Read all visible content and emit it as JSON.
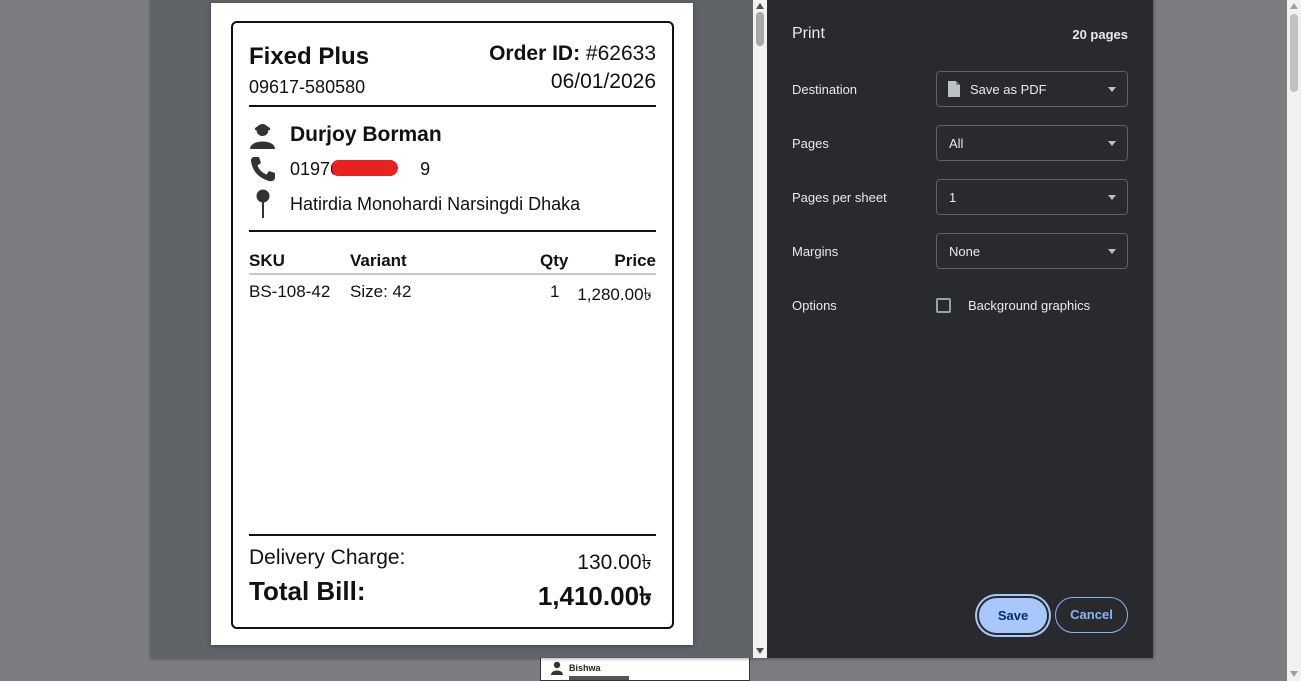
{
  "receipt": {
    "shop_name": "Fixed Plus",
    "shop_phone": "09617-580580",
    "order_label": "Order ID:",
    "order_id": "#62633",
    "date": "06/01/2026",
    "customer_name": "Durjoy Borman",
    "customer_phone_visible_start": "01976",
    "customer_phone_visible_end": "9",
    "address": "Hatirdia Monohardi Narsingdi Dhaka",
    "columns": [
      "SKU",
      "Variant",
      "Qty",
      "Price"
    ],
    "rows": [
      {
        "sku": "BS-108-42",
        "variant": "Size: 42",
        "qty": "1",
        "price": "1,280.00৳"
      }
    ],
    "delivery_label": "Delivery Charge:",
    "delivery_value": "130.00৳",
    "total_label": "Total Bill:",
    "total_value": "1,410.00৳"
  },
  "print_panel": {
    "title": "Print",
    "page_count": "20 pages",
    "destination_label": "Destination",
    "destination_value": "Save as PDF",
    "pages_label": "Pages",
    "pages_value": "All",
    "pages_per_sheet_label": "Pages per sheet",
    "pages_per_sheet_value": "1",
    "margins_label": "Margins",
    "margins_value": "None",
    "options_label": "Options",
    "background_graphics_label": "Background graphics",
    "background_graphics_checked": false,
    "save_label": "Save",
    "cancel_label": "Cancel"
  },
  "background_page": {
    "name": "Bishwa"
  },
  "colors": {
    "panel_bg": "#292a2d",
    "preview_bg": "#5f6368",
    "save_button": "#a8c7fa",
    "cancel_border": "#8ab4f8",
    "redaction": "#e8231f"
  },
  "icons": [
    "person-icon",
    "phone-icon",
    "pin-icon",
    "document-icon",
    "dropdown-caret-icon"
  ]
}
